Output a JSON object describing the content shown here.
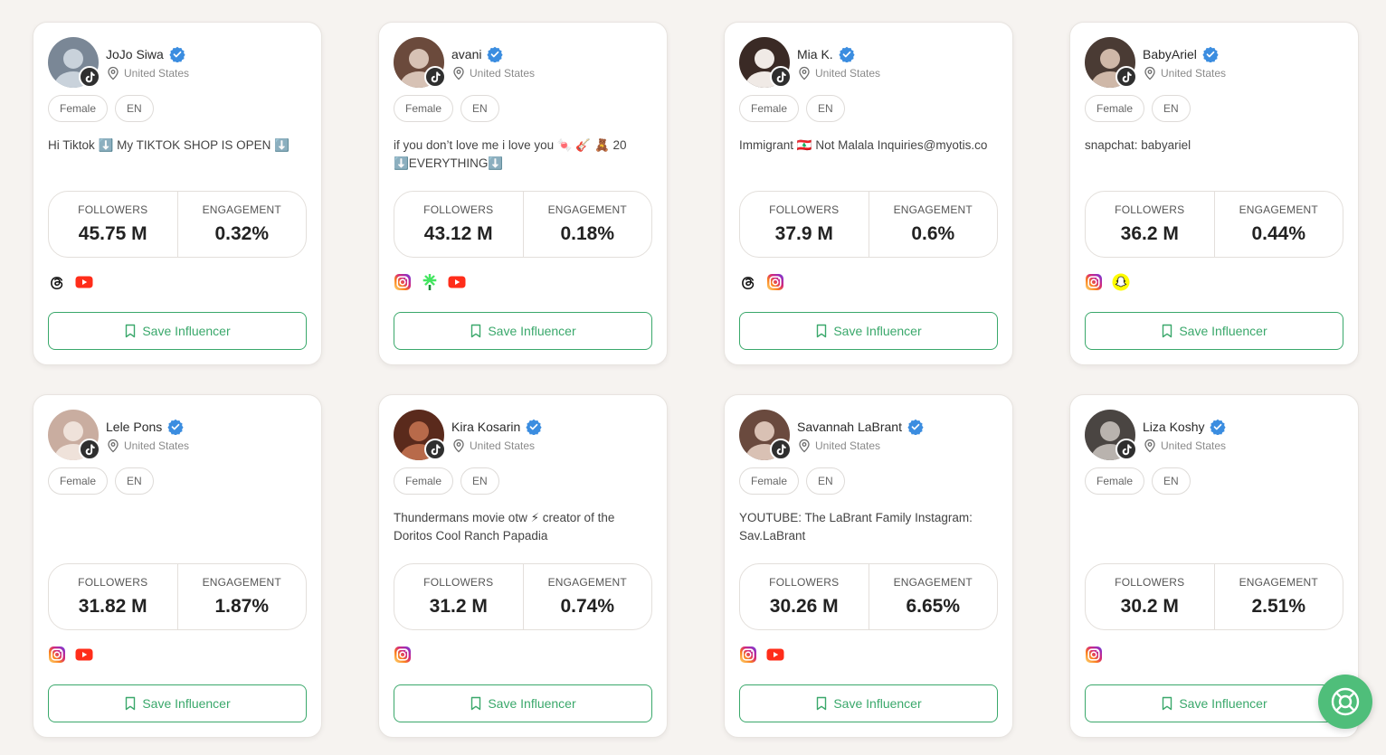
{
  "labels": {
    "followers": "FOLLOWERS",
    "engagement": "ENGAGEMENT",
    "save_button": "Save Influencer"
  },
  "colors": {
    "accent": "#3aa86b",
    "verified": "#3b8de0",
    "background": "#f6f3f0",
    "fab": "#4fbe7a"
  },
  "influencers": [
    {
      "name": "JoJo Siwa",
      "location": "United States",
      "gender": "Female",
      "language": "EN",
      "bio": "Hi Tiktok ⬇️ My TIKTOK SHOP IS OPEN ⬇️",
      "followers": "45.75 M",
      "engagement": "0.32%",
      "socials": [
        "threads-icon",
        "youtube-icon"
      ],
      "avatar_colors": [
        "#7a8796",
        "#c9d2db"
      ]
    },
    {
      "name": "avani",
      "location": "United States",
      "gender": "Female",
      "language": "EN",
      "bio": "if you don’t love me i love you 🍬 🎸 🧸 20 ⬇️EVERYTHING⬇️",
      "followers": "43.12 M",
      "engagement": "0.18%",
      "socials": [
        "instagram-icon",
        "linktree-icon",
        "youtube-icon"
      ],
      "avatar_colors": [
        "#6b4a3c",
        "#d7c2b5"
      ]
    },
    {
      "name": "Mia K.",
      "location": "United States",
      "gender": "Female",
      "language": "EN",
      "bio": "Immigrant 🇱🇧 Not Malala Inquiries@myotis.co",
      "followers": "37.9 M",
      "engagement": "0.6%",
      "socials": [
        "threads-icon",
        "instagram-icon"
      ],
      "avatar_colors": [
        "#3a2a25",
        "#f0eae6"
      ]
    },
    {
      "name": "BabyAriel",
      "location": "United States",
      "gender": "Female",
      "language": "EN",
      "bio": "snapchat: babyariel",
      "followers": "36.2 M",
      "engagement": "0.44%",
      "socials": [
        "instagram-icon",
        "snapchat-icon"
      ],
      "avatar_colors": [
        "#4a3b34",
        "#cfb8a8"
      ]
    },
    {
      "name": "Lele Pons",
      "location": "United States",
      "gender": "Female",
      "language": "EN",
      "bio": "",
      "followers": "31.82 M",
      "engagement": "1.87%",
      "socials": [
        "instagram-icon",
        "youtube-icon"
      ],
      "avatar_colors": [
        "#c9ada0",
        "#efe2da"
      ]
    },
    {
      "name": "Kira Kosarin",
      "location": "United States",
      "gender": "Female",
      "language": "EN",
      "bio": "Thundermans movie otw ⚡ creator of the Doritos Cool Ranch Papadia",
      "followers": "31.2 M",
      "engagement": "0.74%",
      "socials": [
        "instagram-icon"
      ],
      "avatar_colors": [
        "#5a2a1c",
        "#b86a4a"
      ]
    },
    {
      "name": "Savannah LaBrant",
      "location": "United States",
      "gender": "Female",
      "language": "EN",
      "bio": "YOUTUBE: The LaBrant Family Instagram: Sav.LaBrant",
      "followers": "30.26 M",
      "engagement": "6.65%",
      "socials": [
        "instagram-icon",
        "youtube-icon"
      ],
      "avatar_colors": [
        "#6a4a3e",
        "#d9c1b4"
      ]
    },
    {
      "name": "Liza Koshy",
      "location": "United States",
      "gender": "Female",
      "language": "EN",
      "bio": "",
      "followers": "30.2 M",
      "engagement": "2.51%",
      "socials": [
        "instagram-icon"
      ],
      "avatar_colors": [
        "#4a4542",
        "#b9b3ae"
      ]
    }
  ]
}
